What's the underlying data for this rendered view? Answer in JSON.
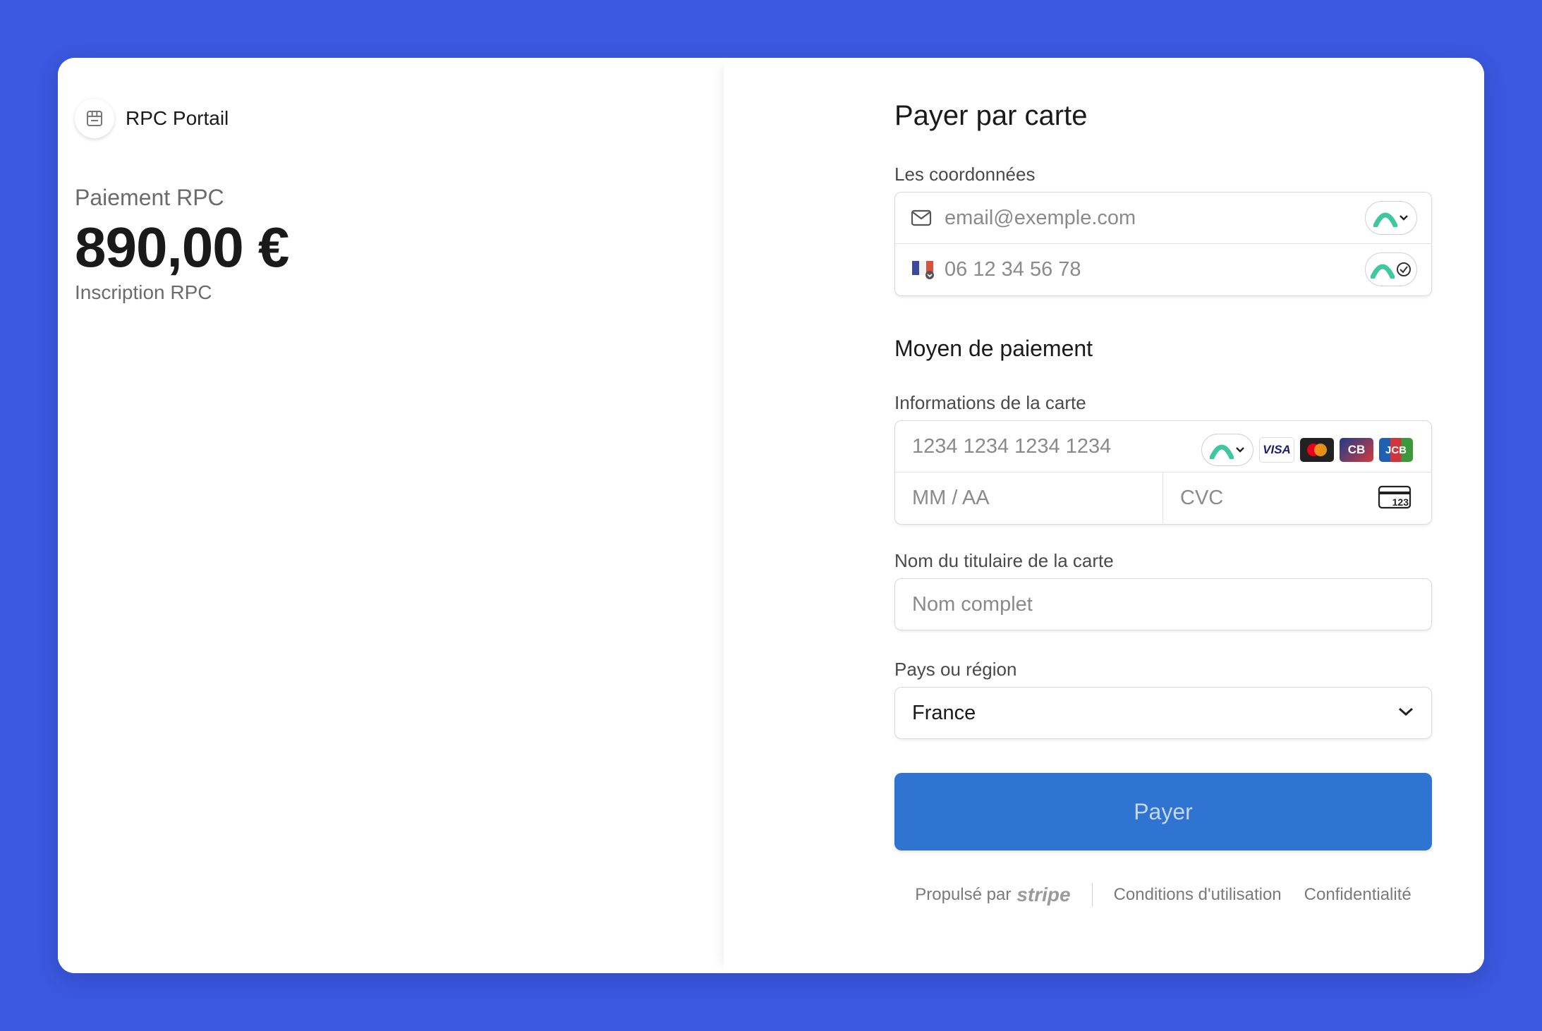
{
  "merchant": {
    "name": "RPC Portail"
  },
  "product": {
    "name": "Paiement RPC",
    "amount": "890,00 €",
    "description": "Inscription RPC"
  },
  "form": {
    "title": "Payer par carte",
    "contact_label": "Les coordonnées",
    "email_placeholder": "email@exemple.com",
    "phone_placeholder": "06 12 34 56 78",
    "payment_section": "Moyen de paiement",
    "card_label": "Informations de la carte",
    "card_number_placeholder": "1234 1234 1234 1234",
    "expiry_placeholder": "MM / AA",
    "cvc_placeholder": "CVC",
    "cvc_icon_text": "123",
    "holder_label": "Nom du titulaire de la carte",
    "holder_placeholder": "Nom complet",
    "country_label": "Pays ou région",
    "country_value": "France",
    "pay_button": "Payer"
  },
  "card_brands": [
    {
      "name": "VISA",
      "icon": "visa-icon"
    },
    {
      "name": "Mastercard",
      "icon": "mastercard-icon"
    },
    {
      "name": "CB",
      "icon": "cartes-bancaires-icon"
    },
    {
      "name": "JCB",
      "icon": "jcb-icon"
    }
  ],
  "footer": {
    "powered_by": "Propulsé par",
    "powered_brand": "stripe",
    "terms": "Conditions d'utilisation",
    "privacy": "Confidentialité"
  },
  "colors": {
    "background": "#3a58e0",
    "pay_button": "#2f74d0",
    "link_green": "#3fc8a0"
  }
}
